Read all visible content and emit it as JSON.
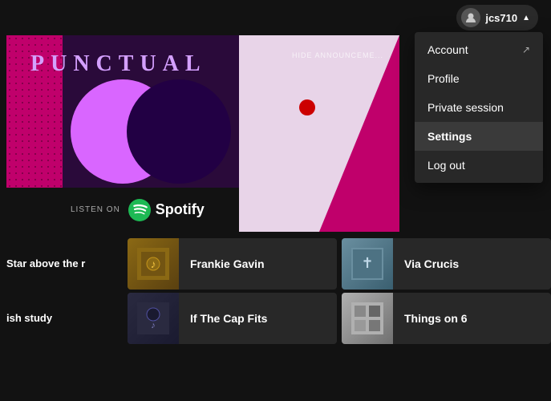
{
  "topbar": {
    "username": "jcs710",
    "arrow": "▲"
  },
  "banner": {
    "title": "PUNCTUAL",
    "hide_text": "HIDE ANNOUNCEME...",
    "listen_on": "LISTEN ON",
    "spotify_text": "Spotify"
  },
  "dropdown": {
    "items": [
      {
        "id": "account",
        "label": "Account",
        "hasIcon": true
      },
      {
        "id": "profile",
        "label": "Profile",
        "hasIcon": false
      },
      {
        "id": "private-session",
        "label": "Private session",
        "hasIcon": false
      },
      {
        "id": "settings",
        "label": "Settings",
        "hasIcon": false,
        "active": true
      },
      {
        "id": "logout",
        "label": "Log out",
        "hasIcon": false
      }
    ]
  },
  "content": {
    "row1": {
      "left_text": "Star above the r",
      "card1": {
        "title": "Frankie Gavin"
      },
      "card2": {
        "title": "Via Crucis"
      }
    },
    "row2": {
      "left_text": "ish study",
      "card1": {
        "title": "If The Cap Fits"
      },
      "card2": {
        "title": "Things on 6"
      }
    }
  }
}
